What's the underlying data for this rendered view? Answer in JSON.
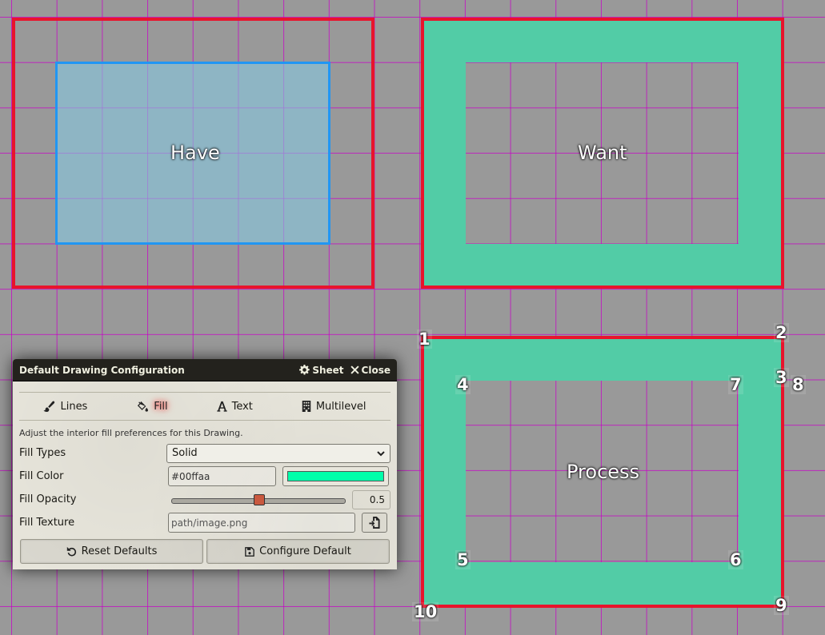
{
  "canvas": {
    "labels": {
      "have": "Have",
      "want": "Want",
      "process": "Process"
    },
    "corner_numbers": [
      "1",
      "2",
      "3",
      "4",
      "5",
      "6",
      "7",
      "8",
      "9",
      "10"
    ],
    "colors": {
      "border_red": "#e8142c",
      "blue_border": "#2196f3",
      "blue_fill": "#8fbcc8",
      "teal_fill": "#52cca6",
      "grid": "#c800c8"
    }
  },
  "dialog": {
    "title": "Default Drawing Configuration",
    "header_buttons": {
      "sheet": "Sheet",
      "close": "Close"
    },
    "tabs": [
      {
        "label": "Lines",
        "icon": "brush-icon"
      },
      {
        "label": "Fill",
        "icon": "fill-drip-icon"
      },
      {
        "label": "Text",
        "icon": "font-icon"
      },
      {
        "label": "Multilevel",
        "icon": "building-icon"
      }
    ],
    "active_tab": "Fill",
    "hint": "Adjust the interior fill preferences for this Drawing.",
    "fields": {
      "fill_types": {
        "label": "Fill Types",
        "value": "Solid"
      },
      "fill_color": {
        "label": "Fill Color",
        "value": "#00ffaa",
        "swatch": "#00ffaa"
      },
      "fill_opacity": {
        "label": "Fill Opacity",
        "value": "0.5"
      },
      "fill_texture": {
        "label": "Fill Texture",
        "placeholder": "path/image.png"
      }
    },
    "footer": {
      "reset": "Reset Defaults",
      "configure": "Configure Default"
    }
  }
}
